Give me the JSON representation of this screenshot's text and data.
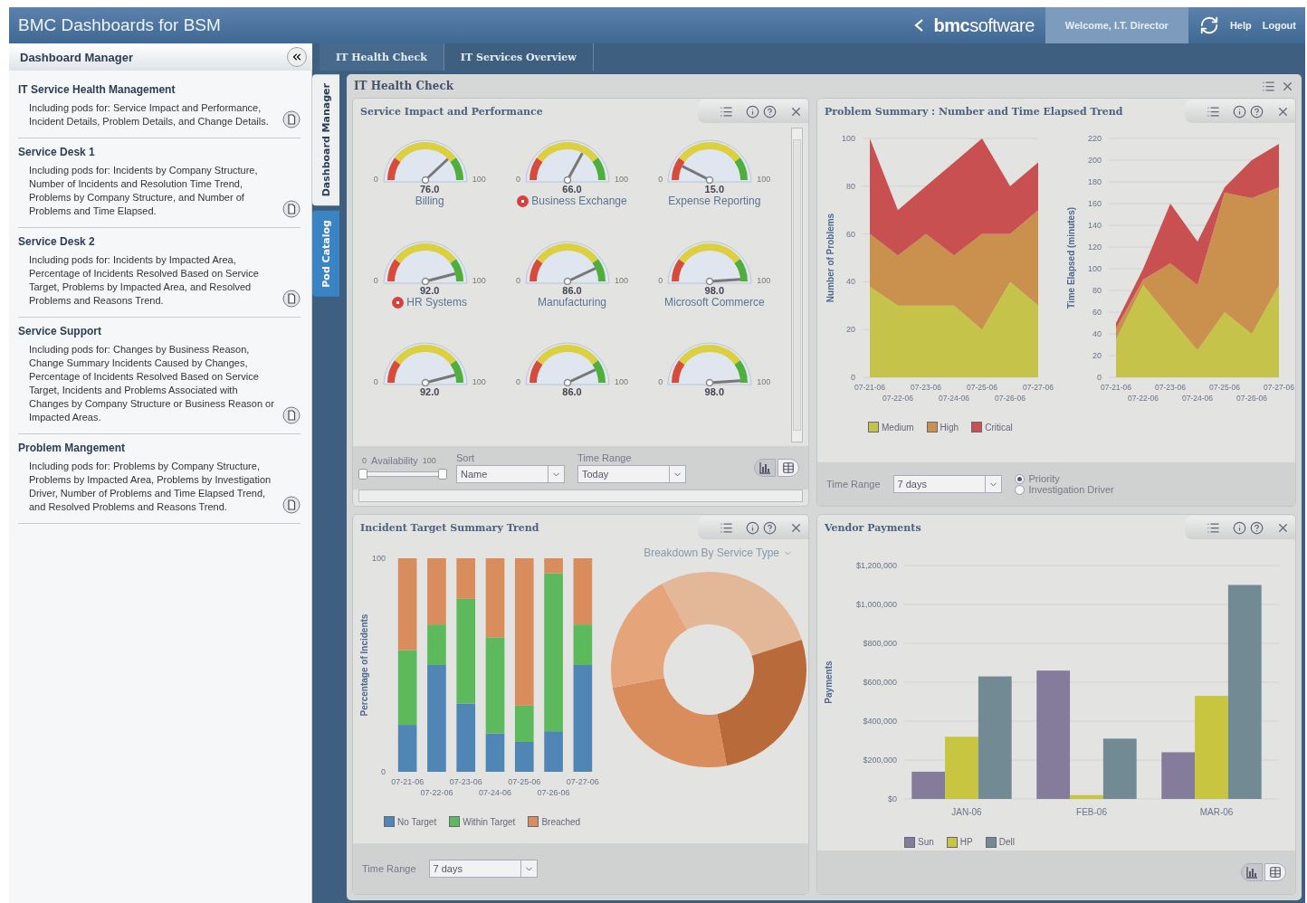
{
  "header": {
    "title": "BMC Dashboards for BSM",
    "logo": "**bmc**software",
    "welcome": "Welcome, I.T. Director",
    "links": [
      "Help",
      "Logout"
    ]
  },
  "sidebar": {
    "title": "Dashboard Manager",
    "items": [
      {
        "title": "IT Service Health Management",
        "description": "Including pods for: Service Impact and Performance, Incident Details, Problem Details, and Change Details."
      },
      {
        "title": "Service Desk 1",
        "description": "Including pods for: Incidents by Company Structure, Number of Incidents and Resolution Time Trend, Problems by Company Structure, and Number of Problems and Time Elapsed."
      },
      {
        "title": "Service Desk 2",
        "description": "Including pods for: Incidents by Impacted Area, Percentage of Incidents Resolved Based on Service Target, Problems by Impacted Area, and Resolved Problems and Reasons Trend."
      },
      {
        "title": "Service Support",
        "description": "Including pods for: Changes by Business Reason, Change Summary Incidents Caused by Changes, Percentage of Incidents Resolved Based on Service Target, Incidents and Problems Associated with Changes by Company Structure or Business Reason or Impacted Areas."
      },
      {
        "title": "Problem Mangement",
        "description": "Including pods for: Problems by Company Structure, Problems by Impacted Area, Problems by Investigation Driver, Number of Problems and Time Elapsed Trend, and Resolved Problems and Reasons Trend."
      }
    ]
  },
  "side_tabs": [
    {
      "label": "Dashboard Manager",
      "selected": true
    },
    {
      "label": "Pod Catalog",
      "selected": false
    }
  ],
  "tabs": [
    {
      "label": "IT Health Check",
      "selected": true
    },
    {
      "label": "IT Services Overview",
      "selected": false
    }
  ],
  "panel": {
    "title": "IT Health Check",
    "pods": [
      {
        "kind": "gauges",
        "title": "Service Impact and Performance",
        "gauges": [
          {
            "min": "0",
            "max": "100",
            "value": "76.0",
            "label": "Billing",
            "alert": false
          },
          {
            "min": "0",
            "max": "100",
            "value": "66.0",
            "label": "Business Exchange",
            "alert": true
          },
          {
            "min": "0",
            "max": "100",
            "value": "15.0",
            "label": "Expense Reporting",
            "alert": false
          },
          {
            "min": "0",
            "max": "100",
            "value": "92.0",
            "label": "HR Systems",
            "alert": true
          },
          {
            "min": "0",
            "max": "100",
            "value": "86.0",
            "label": "Manufacturing",
            "alert": false
          },
          {
            "min": "0",
            "max": "100",
            "value": "98.0",
            "label": "Microsoft Commerce",
            "alert": false
          },
          {
            "min": "0",
            "max": "100",
            "value": "92.0"
          },
          {
            "min": "0",
            "max": "100",
            "value": "86.0"
          },
          {
            "min": "0",
            "max": "100",
            "value": "98.0"
          }
        ],
        "footer": {
          "slider": {
            "label": "Availability",
            "min": "0",
            "max": "100",
            "thumbs": [
              {
                "level": 0
              },
              {
                "level": 1
              }
            ]
          },
          "sort": {
            "label": "Sort",
            "value": "Name"
          },
          "range": {
            "label": "Time Range",
            "value": "Today"
          },
          "views": [
            {
              "kind": "chart",
              "selected": true
            },
            {
              "kind": "table",
              "selected": false
            }
          ]
        }
      },
      {
        "kind": "areas",
        "title": "Problem Summary : Number and Time Elapsed Trend",
        "charts": [
          {
            "chart_data": {
              "type": "area",
              "stacked": true,
              "grid": true,
              "ylabel": "Number of Problems",
              "categories": [
                "07-21-06",
                "07-22-06",
                "07-23-06",
                "07-24-06",
                "07-25-06",
                "07-26-06",
                "07-27-06"
              ],
              "ylim": [
                0,
                100
              ],
              "yticks": [
                0,
                20,
                40,
                60,
                80,
                100
              ],
              "series": [
                {
                  "name": "Medium",
                  "color": "#c5c34a",
                  "values": [
                    38,
                    30,
                    30,
                    30,
                    20,
                    40,
                    30
                  ]
                },
                {
                  "name": "High",
                  "color": "#c9904e",
                  "values": [
                    22,
                    21,
                    30,
                    21,
                    40,
                    20,
                    40
                  ]
                },
                {
                  "name": "Critical",
                  "color": "#c95050",
                  "values": [
                    40,
                    19,
                    20,
                    39,
                    40,
                    20,
                    20
                  ]
                }
              ]
            }
          },
          {
            "chart_data": {
              "type": "area",
              "stacked": true,
              "grid": true,
              "ylabel": "Time Elapsed (minutes)",
              "categories": [
                "07-21-06",
                "07-22-06",
                "07-23-06",
                "07-24-06",
                "07-25-06",
                "07-26-06",
                "07-27-06"
              ],
              "ylim": [
                0,
                220
              ],
              "yticks": [
                0,
                20,
                40,
                60,
                80,
                100,
                120,
                140,
                160,
                180,
                200,
                220
              ],
              "series": [
                {
                  "color": "#c5c34a",
                  "values": [
                    35,
                    85,
                    55,
                    25,
                    60,
                    40,
                    85
                  ]
                },
                {
                  "color": "#c9904e",
                  "values": [
                    10,
                    5,
                    50,
                    60,
                    110,
                    125,
                    90
                  ]
                },
                {
                  "color": "#c95050",
                  "values": [
                    5,
                    10,
                    55,
                    40,
                    5,
                    35,
                    40
                  ]
                }
              ]
            }
          }
        ],
        "footer": {
          "range": {
            "label": "Time Range",
            "value": "7 days"
          },
          "radios": [
            {
              "label": "Priority",
              "selected": true
            },
            {
              "label": "Investigation Driver",
              "selected": false
            }
          ]
        }
      },
      {
        "kind": "incidents",
        "title": "Incident Target Summary Trend",
        "breakdown": "Breakdown By Service Type",
        "chart_data": {
          "type": "bar",
          "stacked": true,
          "ylabel": "Percentage of Incidents",
          "categories": [
            "07-21-06",
            "07-22-06",
            "07-23-06",
            "07-24-06",
            "07-25-06",
            "07-26-06",
            "07-27-06"
          ],
          "ylim": [
            0,
            100
          ],
          "yticks": [
            0,
            100
          ],
          "series": [
            {
              "name": "No Target",
              "color": "#4f86b6",
              "values": [
                22,
                50,
                32,
                18,
                14,
                19,
                50
              ]
            },
            {
              "name": "Within Target",
              "color": "#5cba5c",
              "values": [
                35,
                19,
                49,
                45,
                17,
                74,
                19
              ]
            },
            {
              "name": "Breached",
              "color": "#d98c5c",
              "values": [
                43,
                31,
                19,
                37,
                69,
                7,
                31
              ]
            }
          ]
        },
        "footer": {
          "range": {
            "label": "Time Range",
            "value": "7 days"
          }
        }
      },
      {
        "kind": "payments",
        "title": "Vendor Payments",
        "chart_data": {
          "type": "bar",
          "grid": true,
          "ylabel": "Payments",
          "categories": [
            "JAN-06",
            "FEB-06",
            "MAR-06"
          ],
          "ylim": [
            0,
            1200000
          ],
          "yticks": [
            {
              "value": 0,
              "label": "$0"
            },
            {
              "value": 200000,
              "label": "$200,000"
            },
            {
              "value": 400000,
              "label": "$400,000"
            },
            {
              "value": 600000,
              "label": "$600,000"
            },
            {
              "value": 800000,
              "label": "$800,000"
            },
            {
              "value": 1000000,
              "label": "$1,000,000"
            },
            {
              "value": 1200000,
              "label": "$1,200,000"
            }
          ],
          "series": [
            {
              "name": "Sun",
              "color": "#857c9c",
              "values": [
                140000,
                660000,
                240000
              ]
            },
            {
              "name": "HP",
              "color": "#c8c640",
              "values": [
                320000,
                20000,
                530000
              ]
            },
            {
              "name": "Dell",
              "color": "#728a94",
              "values": [
                630000,
                310000,
                1100000
              ]
            }
          ]
        },
        "footer": {
          "views": [
            {
              "kind": "chart",
              "selected": true
            },
            {
              "kind": "table",
              "selected": false
            }
          ]
        }
      }
    ]
  }
}
